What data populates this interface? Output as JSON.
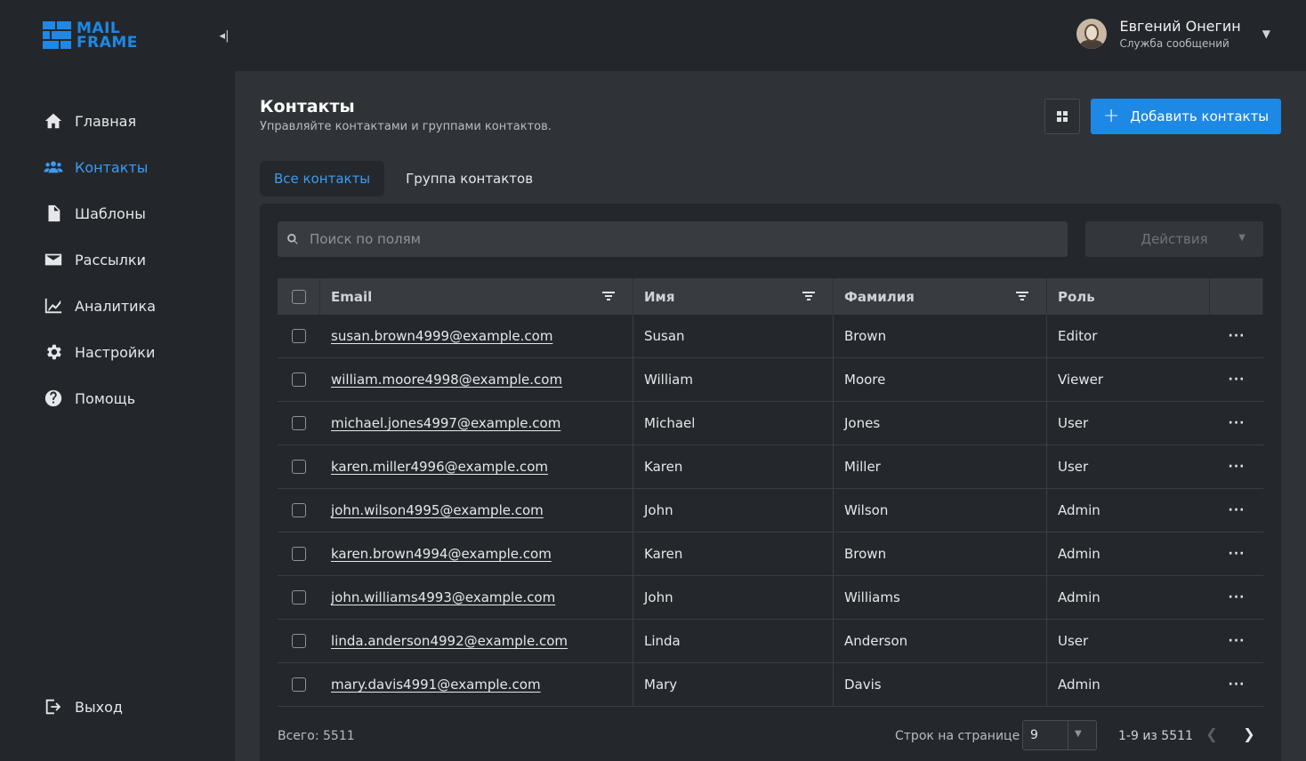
{
  "brand": {
    "line1": "MAIL",
    "line2": "FRAME",
    "accent": "#1e88e5"
  },
  "sidebar": {
    "items": [
      {
        "label": "Главная",
        "icon": "home-icon"
      },
      {
        "label": "Контакты",
        "icon": "contacts-icon",
        "active": true
      },
      {
        "label": "Шаблоны",
        "icon": "document-icon"
      },
      {
        "label": "Рассылки",
        "icon": "mail-icon"
      },
      {
        "label": "Аналитика",
        "icon": "chart-icon"
      },
      {
        "label": "Настройки",
        "icon": "gear-icon"
      },
      {
        "label": "Помощь",
        "icon": "help-icon"
      }
    ],
    "logout_label": "Выход"
  },
  "user": {
    "name": "Евгений Онегин",
    "subtitle": "Служба сообщений"
  },
  "page": {
    "title": "Контакты",
    "subtitle": "Управляйте контактами и группами контактов.",
    "add_button": "Добавить контакты"
  },
  "tabs": [
    {
      "label": "Все контакты",
      "active": true
    },
    {
      "label": "Группа контактов",
      "active": false
    }
  ],
  "search": {
    "placeholder": "Поиск по полям"
  },
  "actions_label": "Действия",
  "table": {
    "columns": {
      "email": "Email",
      "name": "Имя",
      "last": "Фамилия",
      "role": "Роль"
    },
    "rows": [
      {
        "email": "susan.brown4999@example.com",
        "name": "Susan",
        "last": "Brown",
        "role": "Editor"
      },
      {
        "email": "william.moore4998@example.com",
        "name": "William",
        "last": "Moore",
        "role": "Viewer"
      },
      {
        "email": "michael.jones4997@example.com",
        "name": "Michael",
        "last": "Jones",
        "role": "User"
      },
      {
        "email": "karen.miller4996@example.com",
        "name": "Karen",
        "last": "Miller",
        "role": "User"
      },
      {
        "email": "john.wilson4995@example.com",
        "name": "John",
        "last": "Wilson",
        "role": "Admin"
      },
      {
        "email": "karen.brown4994@example.com",
        "name": "Karen",
        "last": "Brown",
        "role": "Admin"
      },
      {
        "email": "john.williams4993@example.com",
        "name": "John",
        "last": "Williams",
        "role": "Admin"
      },
      {
        "email": "linda.anderson4992@example.com",
        "name": "Linda",
        "last": "Anderson",
        "role": "User"
      },
      {
        "email": "mary.davis4991@example.com",
        "name": "Mary",
        "last": "Davis",
        "role": "Admin"
      }
    ]
  },
  "footer": {
    "total": "Всего: 5511",
    "rows_per_page_label": "Строк на странице",
    "rows_per_page": "9",
    "range": "1-9 из 5511"
  }
}
